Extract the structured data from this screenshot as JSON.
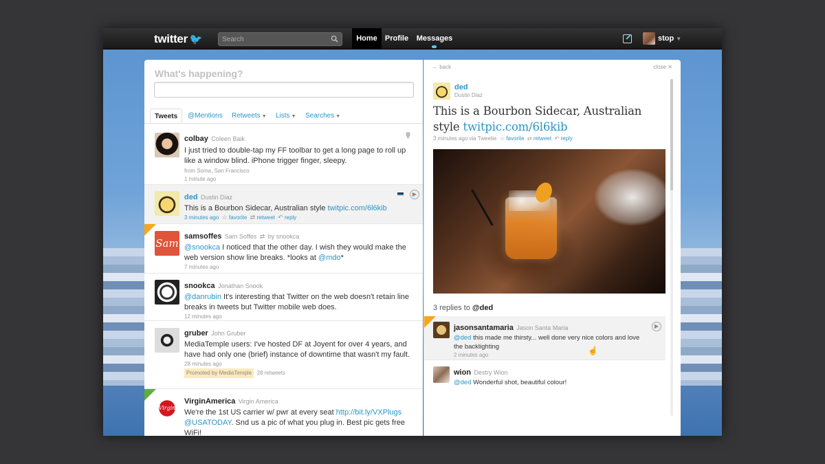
{
  "topbar": {
    "logo": "twitter",
    "search_placeholder": "Search",
    "nav": {
      "home": "Home",
      "profile": "Profile",
      "messages": "Messages"
    },
    "username": "stop"
  },
  "compose": {
    "prompt": "What's happening?"
  },
  "tabs": {
    "tweets": "Tweets",
    "mentions": "@Mentions",
    "retweets": "Retweets",
    "lists": "Lists",
    "searches": "Searches"
  },
  "tweets": [
    {
      "user": "colbay",
      "real": "Coleen Baik",
      "text": "I just tried to double-tap my FF toolbar to get a long page to roll up like a window blind. iPhone trigger finger, sleepy.",
      "source": "from Soma, San Francisco",
      "time": "1 minute ago"
    },
    {
      "user": "ded",
      "real": "Dustin Diaz",
      "text": "This is a Bourbon Sidecar, Australian style ",
      "link": "twitpic.com/6l6kib",
      "time": "3 minutes ago",
      "favorite": "favorite",
      "retweet": "retweet",
      "reply": "reply"
    },
    {
      "user": "samsoffes",
      "real": "Sam Soffes",
      "retweet_by": "by snookca",
      "mention": "@snookca",
      "text_a": " I noticed that the other day. I wish they would make the web version show line breaks. *looks at ",
      "mention2": "@mdo",
      "text_b": "*",
      "time": "7 minutes ago",
      "avatar_text": "Sam"
    },
    {
      "user": "snookca",
      "real": "Jonathan Snook",
      "mention": "@danrubin",
      "text": " It's interesting that Twitter on the web doesn't retain line breaks in tweets but Twitter mobile web does.",
      "time": "12 minutes ago"
    },
    {
      "user": "gruber",
      "real": "John Gruber",
      "text": "MediaTemple users: I've hosted DF at Joyent for over 4 years, and have had only one (brief) instance of downtime that wasn't my fault.",
      "time": "28 minutes ago",
      "promoted": "Promoted by MediaTemple",
      "retweets": "28 retweets"
    },
    {
      "user": "VirginAmerica",
      "real": "Virgin America",
      "text_a": "We're the 1st US carrier w/ pwr at every seat ",
      "link": "http://bit.ly/VXPlugs",
      "mention": "@USATODAY",
      "text_b": ". Snd us a pic of what you plug in. Best pic gets free WiFi!",
      "avatar_text": "Virgin"
    }
  ],
  "detail": {
    "back": "← back",
    "close": "close ✕",
    "user": "ded",
    "real": "Dustin Diaz",
    "text": "This is a Bourbon Sidecar, Australian style ",
    "link": "twitpic.com/6l6kib",
    "meta": "3 minutes ago via Tweetie",
    "favorite": "favorite",
    "retweet": "retweet",
    "reply": "reply",
    "replies_prefix": "3 replies to ",
    "replies_target": "@ded"
  },
  "replies": [
    {
      "user": "jasonsantamaria",
      "real": "Jason Santa Maria",
      "mention": "@ded",
      "text": " this made me thirsty... well done very nice colors and love the backlighting",
      "time": "2 minutes ago"
    },
    {
      "user": "wion",
      "real": "Destry Wion",
      "mention": "@ded",
      "text": " Wonderful shot, beautiful colour!"
    }
  ],
  "colors": {
    "link": "#2a96c7",
    "topbar": "#1f1f1f",
    "accent": "#5ec5ef",
    "highlight_corner": "#f7a51c"
  }
}
